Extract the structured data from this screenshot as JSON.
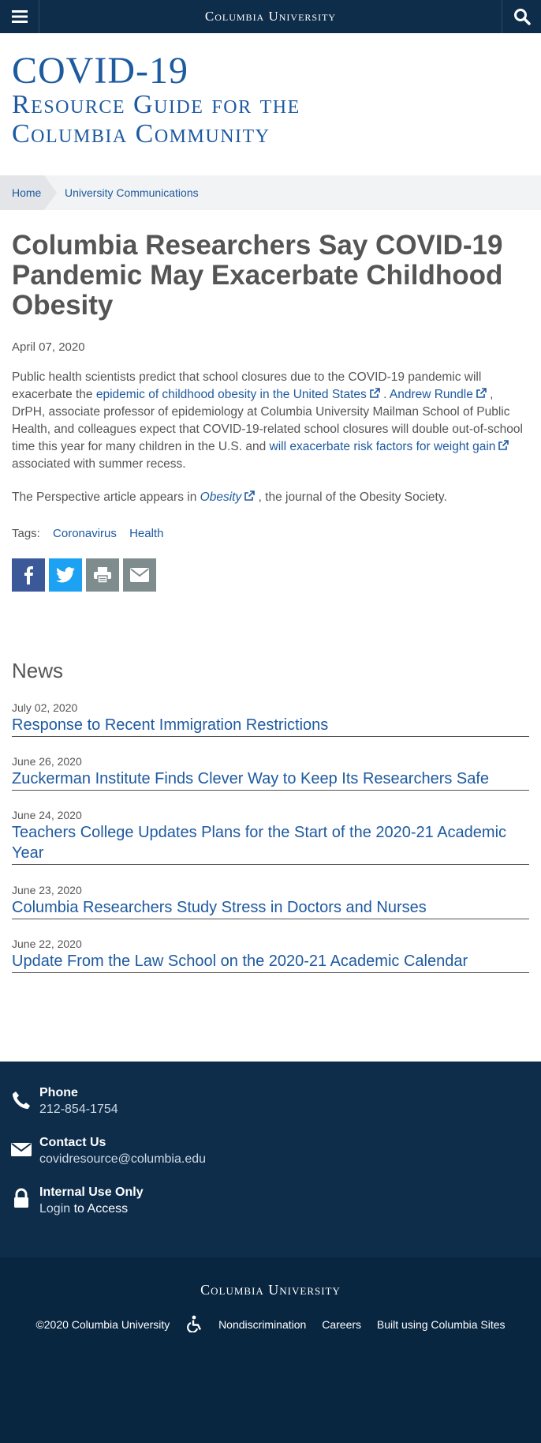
{
  "header": {
    "brand": "Columbia University",
    "menu_icon": "hamburger-icon",
    "search_icon": "search-icon"
  },
  "site": {
    "title_line1": "COVID-19",
    "title_line2": "Resource Guide for the",
    "title_line3": "Columbia Community"
  },
  "breadcrumb": {
    "home": "Home",
    "current": "University Communications"
  },
  "article": {
    "title": "Columbia Researchers Say COVID-19 Pandemic May Exacerbate Childhood Obesity",
    "date": "April 07, 2020",
    "p1_a": "Public health scientists predict that school closures due to the COVID-19 pandemic will exacerbate the",
    "p1_link1": "epidemic of childhood obesity in the United States",
    "p1_b": ".",
    "p1_link2": "Andrew Rundle",
    "p1_c": ", DrPH, associate professor of epidemiology at Columbia University Mailman School of Public Health, and colleagues expect that COVID-19-related school closures will double out-of-school time this year for many children in the U.S. and",
    "p1_link3": "will exacerbate risk factors for weight gain",
    "p1_d": "associated with summer recess.",
    "p2_a": "The Perspective article appears in",
    "p2_link": "Obesity",
    "p2_b": ", the journal of the Obesity Society.",
    "tags_label": "Tags:",
    "tags": [
      "Coronavirus",
      "Health"
    ],
    "share": [
      "facebook-icon",
      "twitter-icon",
      "print-icon",
      "email-icon"
    ]
  },
  "news": {
    "heading": "News",
    "items": [
      {
        "date": "July 02, 2020",
        "title": "Response to Recent Immigration Restrictions"
      },
      {
        "date": "June 26, 2020",
        "title": "Zuckerman Institute Finds Clever Way to Keep Its Researchers Safe"
      },
      {
        "date": "June 24, 2020",
        "title": "Teachers College Updates Plans for the Start of the 2020-21 Academic Year"
      },
      {
        "date": "June 23, 2020",
        "title": "Columbia Researchers Study Stress in Doctors and Nurses"
      },
      {
        "date": "June 22, 2020",
        "title": "Update From the Law School on the 2020-21 Academic Calendar"
      }
    ]
  },
  "footer": {
    "phone_label": "Phone",
    "phone_value": "212-854-1754",
    "contact_label": "Contact Us",
    "contact_value": "covidresource@columbia.edu",
    "internal_label": "Internal Use Only",
    "login_link": "Login",
    "login_suffix": "to Access",
    "brand": "Columbia University",
    "copyright": "©2020 Columbia University",
    "nondiscrimination": "Nondiscrimination",
    "careers": "Careers",
    "built": "Built using Columbia Sites"
  },
  "colors": {
    "navy": "#0d2d4b",
    "link": "#1e5aa0",
    "text": "#555555",
    "facebook": "#3b5998",
    "twitter": "#1da1f2",
    "print": "#7f8c8d"
  }
}
